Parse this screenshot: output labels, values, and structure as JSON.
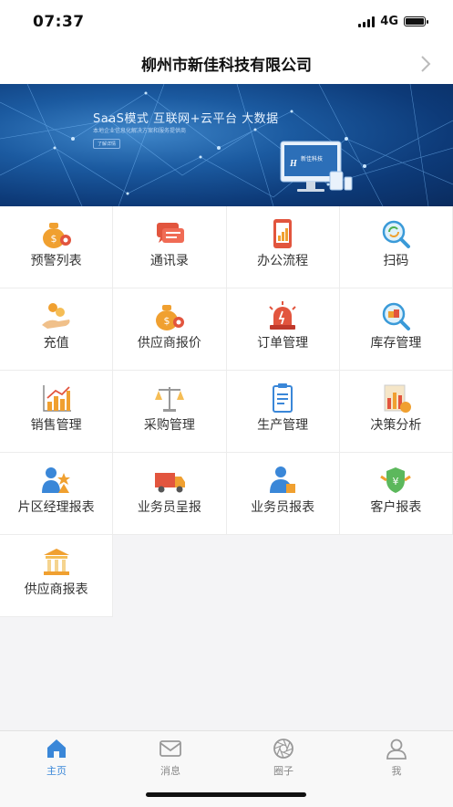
{
  "status_bar": {
    "time": "07:37",
    "network": "4G"
  },
  "header": {
    "title": "柳州市新佳科技有限公司"
  },
  "banner": {
    "headline": "SaaS模式 互联网+云平台 大数据",
    "subline": "本地企业信息化解决方案和服务提供商",
    "button_label": "了解详情",
    "brand_label": "新佳科技"
  },
  "menu": {
    "items": [
      {
        "label": "预警列表",
        "icon": "money-bag-gear-icon"
      },
      {
        "label": "通讯录",
        "icon": "chat-bubbles-icon"
      },
      {
        "label": "办公流程",
        "icon": "tablet-chart-icon"
      },
      {
        "label": "扫码",
        "icon": "scan-magnifier-icon"
      },
      {
        "label": "充值",
        "icon": "hand-coins-icon"
      },
      {
        "label": "供应商报价",
        "icon": "money-bag-gear-icon"
      },
      {
        "label": "订单管理",
        "icon": "alarm-siren-icon"
      },
      {
        "label": "库存管理",
        "icon": "inventory-magnifier-icon"
      },
      {
        "label": "销售管理",
        "icon": "bar-chart-icon"
      },
      {
        "label": "采购管理",
        "icon": "balance-scale-icon"
      },
      {
        "label": "生产管理",
        "icon": "clipboard-icon"
      },
      {
        "label": "决策分析",
        "icon": "decision-chart-icon"
      },
      {
        "label": "片区经理报表",
        "icon": "manager-star-icon"
      },
      {
        "label": "业务员呈报",
        "icon": "delivery-truck-icon"
      },
      {
        "label": "业务员报表",
        "icon": "salesman-icon"
      },
      {
        "label": "客户报表",
        "icon": "customer-badge-icon"
      },
      {
        "label": "供应商报表",
        "icon": "bank-building-icon"
      }
    ]
  },
  "tabbar": {
    "tabs": [
      {
        "label": "主页",
        "icon": "home-icon",
        "active": true
      },
      {
        "label": "消息",
        "icon": "envelope-icon",
        "active": false
      },
      {
        "label": "圈子",
        "icon": "aperture-icon",
        "active": false
      },
      {
        "label": "我",
        "icon": "person-icon",
        "active": false
      }
    ]
  },
  "colors": {
    "accent": "#3a87d8",
    "banner_blue": "#1b5aa0",
    "orange": "#f0a030",
    "red": "#e2553e"
  }
}
